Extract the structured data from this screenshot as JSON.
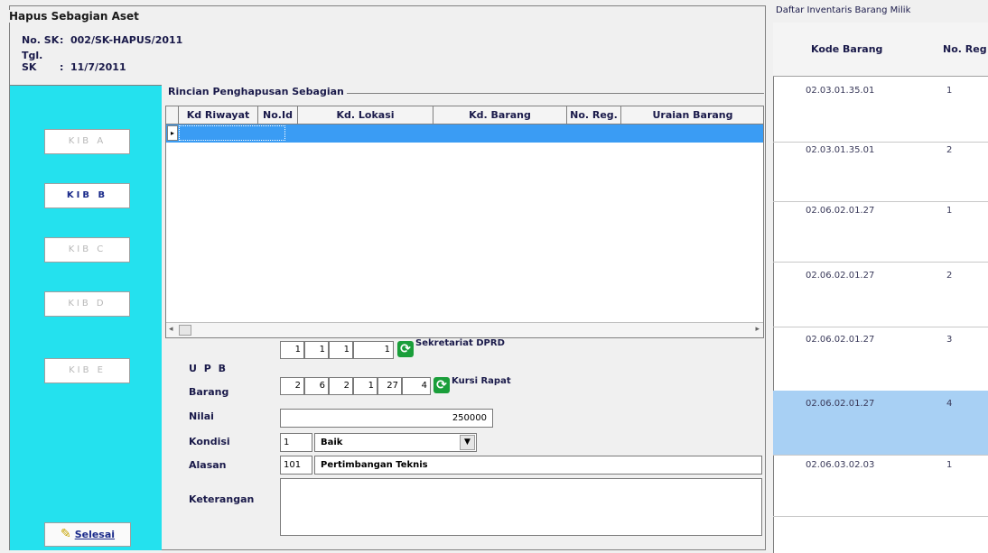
{
  "header": {
    "frame_title": "Hapus Sebagian Aset",
    "no_sk_label": "No. SK",
    "no_sk_value": "002/SK-HAPUS/2011",
    "tgl_sk_label": "Tgl. SK",
    "tgl_sk_value": "11/7/2011"
  },
  "kib_buttons": [
    {
      "label": "KIB A",
      "state": "disabled"
    },
    {
      "label": "KIB B",
      "state": "active"
    },
    {
      "label": "KIB C",
      "state": "disabled"
    },
    {
      "label": "KIB D",
      "state": "disabled"
    },
    {
      "label": "KIB E",
      "state": "disabled"
    }
  ],
  "selesai_label": "Selesai",
  "rincian": {
    "title": "Rincian Penghapusan Sebagian",
    "columns": [
      "Kd Riwayat",
      "No.Id",
      "Kd. Lokasi",
      "Kd. Barang",
      "No. Reg.",
      "Uraian Barang"
    ],
    "rows": [
      {
        "row_marker": "▸",
        "kd_riwayat": "",
        "no_id": "",
        "kd_lokasi": "",
        "kd_barang": "",
        "no_reg": "",
        "uraian": ""
      }
    ]
  },
  "form": {
    "upb_label": "U P B",
    "upb_codes": [
      "1",
      "1",
      "1",
      "1"
    ],
    "upb_name": "Sekretariat DPRD",
    "barang_label": "Barang",
    "barang_codes": [
      "2",
      "6",
      "2",
      "1",
      "27",
      "4"
    ],
    "barang_name": "Kursi Rapat",
    "nilai_label": "Nilai",
    "nilai_value": "250000",
    "kondisi_label": "Kondisi",
    "kondisi_code": "1",
    "kondisi_value": "Baik",
    "alasan_label": "Alasan",
    "alasan_code": "101",
    "alasan_value": "Pertimbangan Teknis",
    "keterangan_label": "Keterangan",
    "keterangan_value": ""
  },
  "right_panel": {
    "title": "Daftar Inventaris Barang Milik",
    "columns": [
      "Kode Barang",
      "No. Reg"
    ],
    "rows": [
      {
        "kode": "02.03.01.35.01",
        "reg": "1"
      },
      {
        "kode": "02.03.01.35.01",
        "reg": "2"
      },
      {
        "kode": "02.06.02.01.27",
        "reg": "1"
      },
      {
        "kode": "02.06.02.01.27",
        "reg": "2"
      },
      {
        "kode": "02.06.02.01.27",
        "reg": "3"
      },
      {
        "kode": "02.06.02.01.27",
        "reg": "4"
      },
      {
        "kode": "02.06.03.02.03",
        "reg": "1"
      }
    ],
    "selected_row": 5
  },
  "colors": {
    "kib_panel_bg": "#24e1ee",
    "selected_row_bg": "#3a9cf4",
    "right_selected_bg": "#a8d0f4",
    "refresh_icon": "#1a9e3a"
  }
}
